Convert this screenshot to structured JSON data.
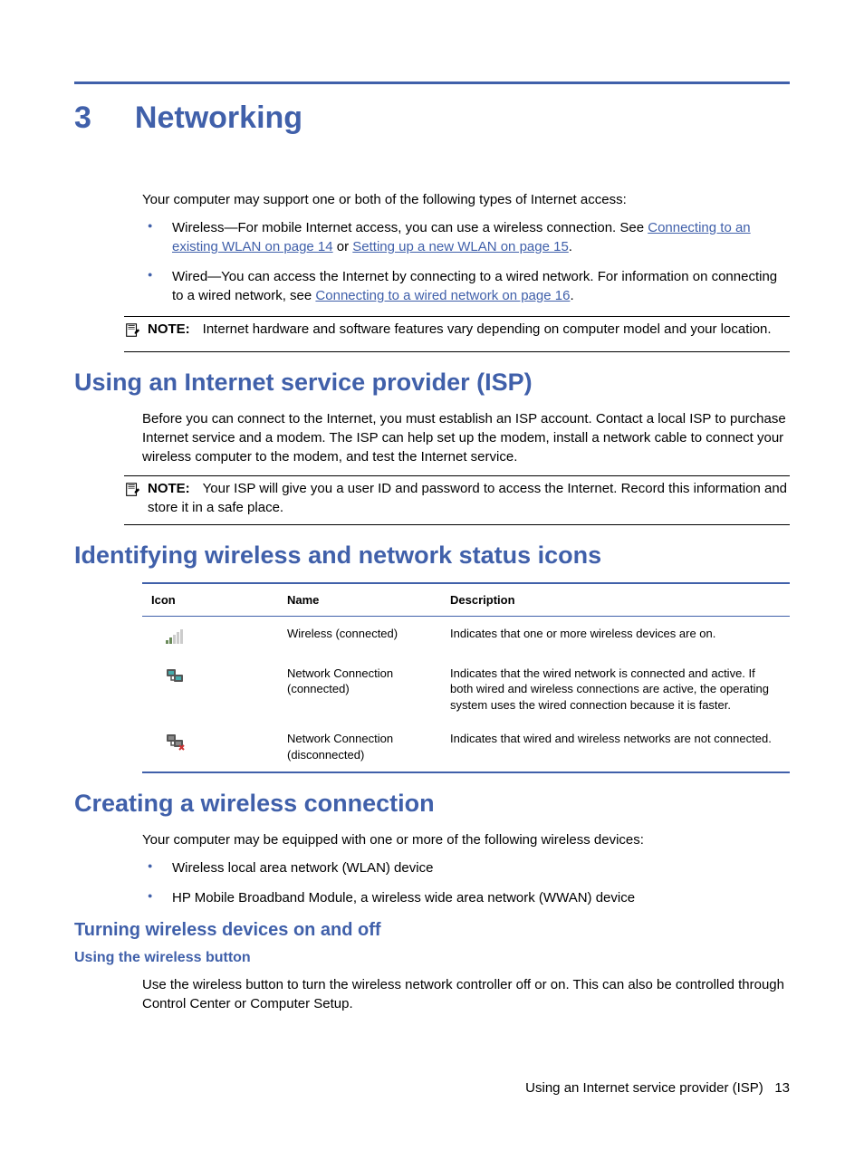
{
  "chapter": {
    "number": "3",
    "title": "Networking"
  },
  "intro": "Your computer may support one or both of the following types of Internet access:",
  "access_types": [
    {
      "pre": "Wireless—For mobile Internet access, you can use a wireless connection. See ",
      "link1": "Connecting to an existing WLAN on page 14",
      "mid": " or ",
      "link2": "Setting up a new WLAN on page 15",
      "post": "."
    },
    {
      "pre": "Wired—You can access the Internet by connecting to a wired network. For information on connecting to a wired network, see ",
      "link1": "Connecting to a wired network on page 16",
      "mid": "",
      "link2": "",
      "post": "."
    }
  ],
  "note1": {
    "label": "NOTE:",
    "text": "Internet hardware and software features vary depending on computer model and your location."
  },
  "isp": {
    "heading": "Using an Internet service provider (ISP)",
    "body": "Before you can connect to the Internet, you must establish an ISP account. Contact a local ISP to purchase Internet service and a modem. The ISP can help set up the modem, install a network cable to connect your wireless computer to the modem, and test the Internet service."
  },
  "note2": {
    "label": "NOTE:",
    "text": "Your ISP will give you a user ID and password to access the Internet. Record this information and store it in a safe place."
  },
  "icons_heading": "Identifying wireless and network status icons",
  "table": {
    "headers": {
      "icon": "Icon",
      "name": "Name",
      "desc": "Description"
    },
    "rows": [
      {
        "icon": "wireless",
        "name": "Wireless (connected)",
        "desc": "Indicates that one or more wireless devices are on."
      },
      {
        "icon": "net-connected",
        "name": "Network Connection (connected)",
        "desc": "Indicates that the wired network is connected and active. If both wired and wireless connections are active, the operating system uses the wired connection because it is faster."
      },
      {
        "icon": "net-disconnected",
        "name": "Network Connection (disconnected)",
        "desc": "Indicates that wired and wireless networks are not connected."
      }
    ]
  },
  "creating": {
    "heading": "Creating a wireless connection",
    "intro": "Your computer may be equipped with one or more of the following wireless devices:",
    "items": [
      "Wireless local area network (WLAN) device",
      "HP Mobile Broadband Module, a wireless wide area network (WWAN) device"
    ]
  },
  "turning": {
    "heading": "Turning wireless devices on and off"
  },
  "wireless_button": {
    "heading": "Using the wireless button",
    "body": "Use the wireless button to turn the wireless network controller off or on. This can also be controlled through Control Center or Computer Setup."
  },
  "footer": {
    "text": "Using an Internet service provider (ISP)",
    "page": "13"
  }
}
